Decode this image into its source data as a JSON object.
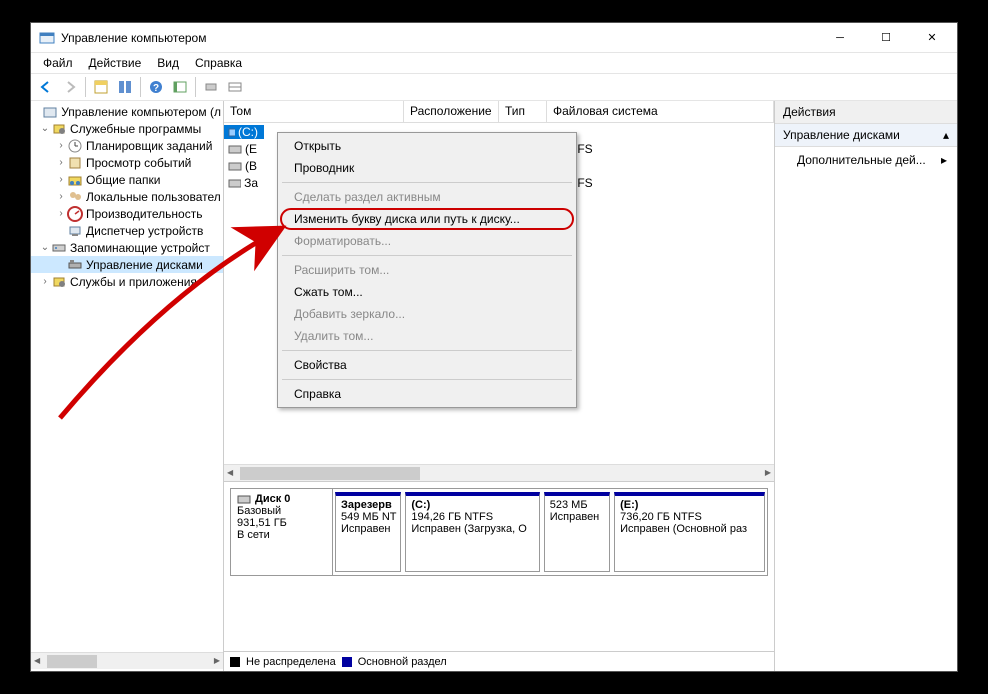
{
  "window": {
    "title": "Управление компьютером"
  },
  "menu": {
    "file": "Файл",
    "action": "Действие",
    "view": "Вид",
    "help": "Справка"
  },
  "tree": {
    "root": "Управление компьютером (л",
    "n1": "Служебные программы",
    "n1a": "Планировщик заданий",
    "n1b": "Просмотр событий",
    "n1c": "Общие папки",
    "n1d": "Локальные пользовател",
    "n1e": "Производительность",
    "n1f": "Диспетчер устройств",
    "n2": "Запоминающие устройст",
    "n2a": "Управление дисками",
    "n3": "Службы и приложения"
  },
  "vol_headers": {
    "tom": "Том",
    "loc": "Расположение",
    "type": "Тип",
    "fs": "Файловая система"
  },
  "vol_rows": {
    "r0": {
      "tom": "(C:)",
      "fs": ""
    },
    "r1": {
      "tom": "(E",
      "fs": "TFS"
    },
    "r2": {
      "tom": "(В",
      "fs": ""
    },
    "r3": {
      "tom": "За",
      "fs": "TFS"
    }
  },
  "context": {
    "open": "Открыть",
    "explorer": "Проводник",
    "make_active": "Сделать раздел активным",
    "change_letter": "Изменить букву диска или путь к диску...",
    "format": "Форматировать...",
    "extend": "Расширить том...",
    "shrink": "Сжать том...",
    "mirror": "Добавить зеркало...",
    "delete": "Удалить том...",
    "properties": "Свойства",
    "help": "Справка"
  },
  "disk": {
    "label": "Диск 0",
    "type": "Базовый",
    "size": "931,51 ГБ",
    "status": "В сети",
    "parts": [
      {
        "name": "Зарезерв",
        "size": "549 МБ NT",
        "status": "Исправен"
      },
      {
        "name": "(C:)",
        "size": "194,26 ГБ NTFS",
        "status": "Исправен (Загрузка, О"
      },
      {
        "name": "",
        "size": "523 МБ",
        "status": "Исправен"
      },
      {
        "name": "(E:)",
        "size": "736,20 ГБ NTFS",
        "status": "Исправен (Основной раз"
      }
    ]
  },
  "legend": {
    "unalloc": "Не распределена",
    "primary": "Основной раздел"
  },
  "actions": {
    "title": "Действия",
    "dm": "Управление дисками",
    "more": "Дополнительные дей..."
  }
}
